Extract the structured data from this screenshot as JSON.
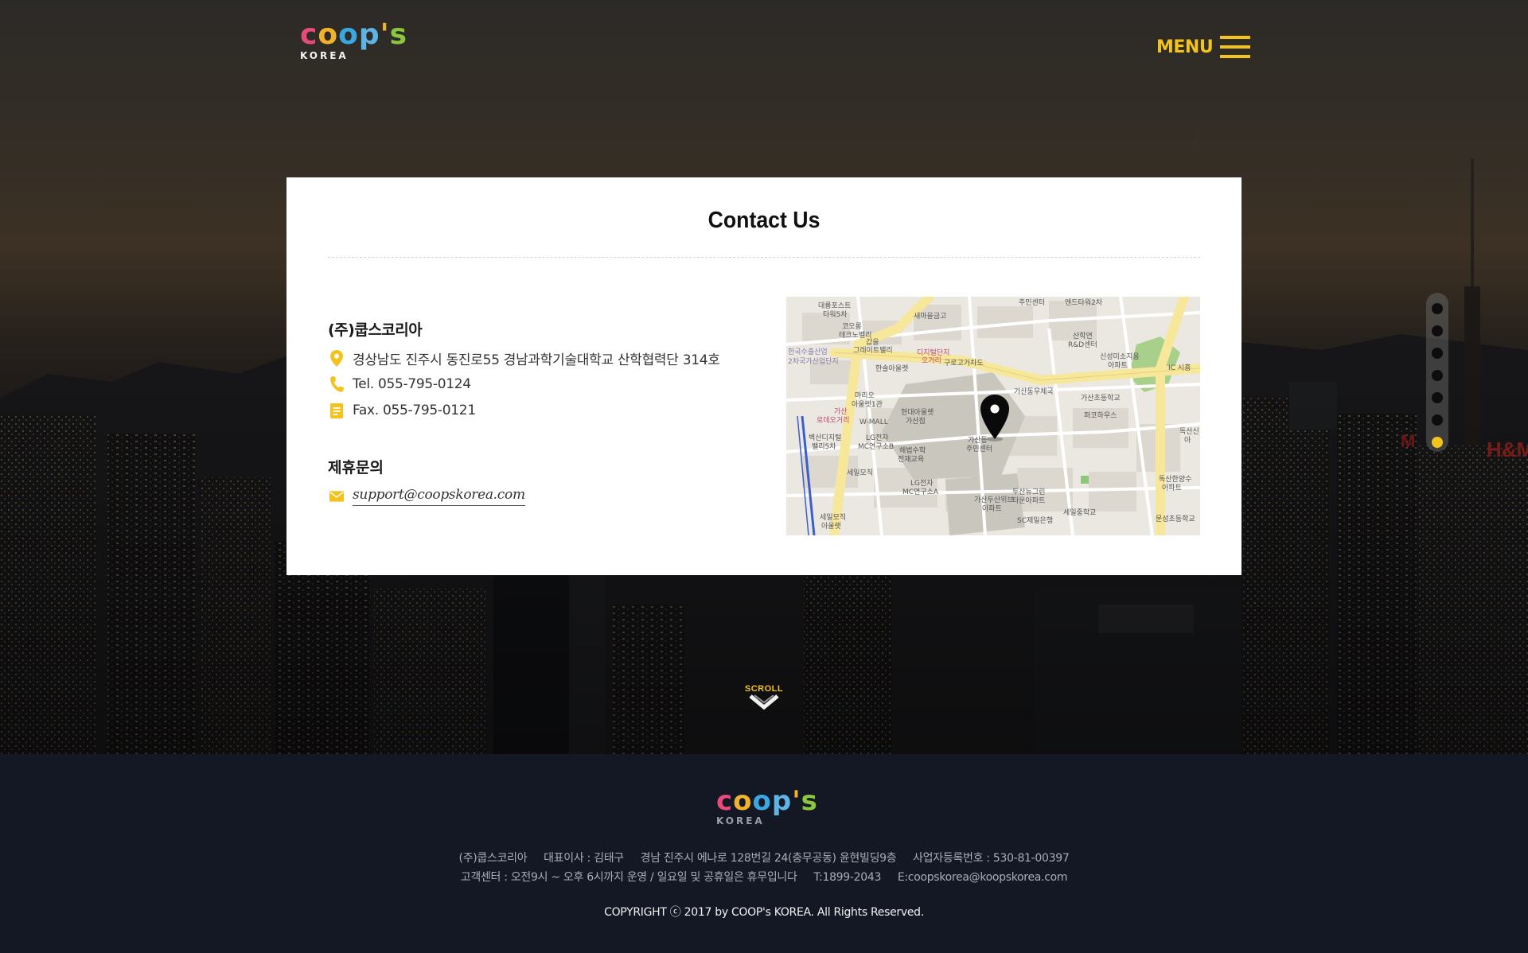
{
  "brand": {
    "logo_letters": [
      "c",
      "o",
      "o",
      "p",
      "'",
      "s"
    ],
    "logo_sub": "KOREA",
    "colors": {
      "pink": "#e84b7a",
      "yellow": "#f0b22a",
      "blue": "#3aa7e0",
      "green": "#8cc63e",
      "accent": "#f3c21b"
    }
  },
  "header": {
    "menu_label": "MENU",
    "menu_icon": "hamburger-icon"
  },
  "contact": {
    "title": "Contact Us",
    "company": "(주)쿱스코리아",
    "address": "경상남도 진주시 동진로55 경남과학기술대학교 산학협력단 314호",
    "tel": "Tel. 055-795-0124",
    "fax": "Fax. 055-795-0121",
    "partnership_title": "제휴문의",
    "email": "support@coopskorea.com",
    "icons": {
      "address": "location-pin-icon",
      "tel": "phone-icon",
      "fax": "document-icon",
      "email": "envelope-icon"
    }
  },
  "map": {
    "labels": [
      "대륭포스트 타워5차",
      "코오롱 테크노밸리",
      "새마을금고",
      "주민센터",
      "엔드타워2차",
      "한국수출산업 2차국가산업단지",
      "갑을 그레이트밸리",
      "디지털단지 오거리",
      "구로고가차도",
      "산학연 R&D센터",
      "신성미소지움 아파트",
      "한솔아울렛",
      "가산동우체국",
      "가산초등학교",
      "마리오 아울렛1관",
      "현대아울렛 가산점",
      "가산 로데오거리",
      "W-MALL",
      "퍼코하우스",
      "LG전자 MC연구소B",
      "벽산디지털 밸리5차",
      "가산동 주민센터",
      "독산신 아파트",
      "해법수학 전재교육",
      "세일모직",
      "LG전자 MC연구소A",
      "가산두산위브 아파트",
      "두산뉴그린 타운아파트",
      "독산한양수 아파트",
      "세일모직 아울렛",
      "SC제일은행",
      "세일중학교",
      "문성초등학교",
      "IC 시흥"
    ],
    "pin_icon": "map-marker-icon"
  },
  "pager": {
    "count": 7,
    "active_index": 6
  },
  "scroll": {
    "label": "SCROLL",
    "icon": "chevron-down-icon"
  },
  "footer": {
    "line1": "(주)쿱스코리아     대표이사 : 김태구     경남 진주시 에나로 128번길 24(충무공동) 윤현빌딩9층     사업자등록번호 : 530-81-00397",
    "line2": "고객센터 : 오전9시 ~ 오후 6시까지 운영 / 일요일 및 공휴일은 휴무입니다     T:1899-2043     E:coopskorea@koopskorea.com",
    "copyright": "COPYRIGHT ⓒ 2017 by COOP's KOREA. All Rights Reserved."
  }
}
